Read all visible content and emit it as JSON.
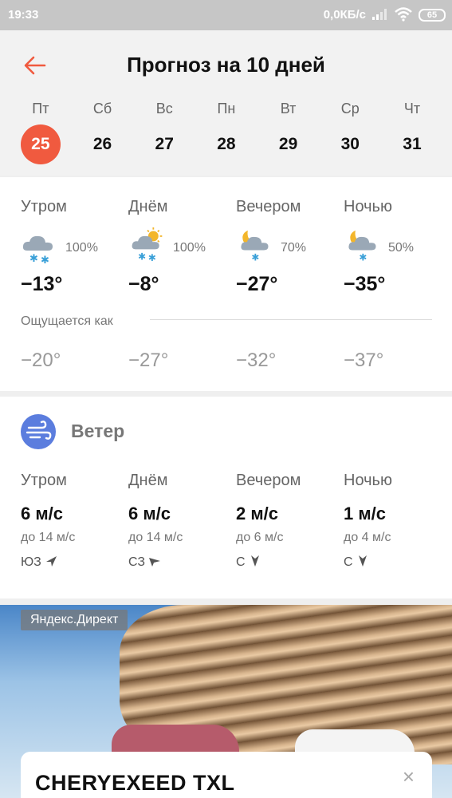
{
  "status": {
    "time": "19:33",
    "net": "0,0КБ/с",
    "battery": "65"
  },
  "header": {
    "title": "Прогноз на 10 дней",
    "days": [
      {
        "dow": "Пт",
        "num": "25",
        "active": true
      },
      {
        "dow": "Сб",
        "num": "26"
      },
      {
        "dow": "Вс",
        "num": "27"
      },
      {
        "dow": "Пн",
        "num": "28"
      },
      {
        "dow": "Вт",
        "num": "29"
      },
      {
        "dow": "Ср",
        "num": "30"
      },
      {
        "dow": "Чт",
        "num": "31"
      }
    ]
  },
  "forecast": {
    "periods": [
      {
        "label": "Утром",
        "icon": "cloud-snow-icon",
        "precip": "100%",
        "temp": "−13°",
        "feels": "−20°"
      },
      {
        "label": "Днём",
        "icon": "partly-sunny-snow-icon",
        "precip": "100%",
        "temp": "−8°",
        "feels": "−27°"
      },
      {
        "label": "Вечером",
        "icon": "moon-cloud-snow-icon",
        "precip": "70%",
        "temp": "−27°",
        "feels": "−32°"
      },
      {
        "label": "Ночью",
        "icon": "moon-cloud-snow-icon",
        "precip": "50%",
        "temp": "−35°",
        "feels": "−37°"
      }
    ],
    "feels_label": "Ощущается как"
  },
  "wind": {
    "title": "Ветер",
    "icon": "wind-icon",
    "periods": [
      {
        "label": "Утром",
        "speed": "6 м/с",
        "max": "до 14 м/с",
        "dir": "ЮЗ"
      },
      {
        "label": "Днём",
        "speed": "6 м/с",
        "max": "до 14 м/с",
        "dir": "СЗ"
      },
      {
        "label": "Вечером",
        "speed": "2 м/с",
        "max": "до 6 м/с",
        "dir": "С"
      },
      {
        "label": "Ночью",
        "speed": "1 м/с",
        "max": "до 4 м/с",
        "dir": "С"
      }
    ]
  },
  "ad": {
    "label": "Яндекс.Директ",
    "title": "CHERYEXEED TXL",
    "close": "×"
  },
  "colors": {
    "accent": "#f05a3f",
    "wind_icon_bg": "#5b7dde",
    "snow": "#3aa0d8",
    "sun": "#f3b62b"
  }
}
